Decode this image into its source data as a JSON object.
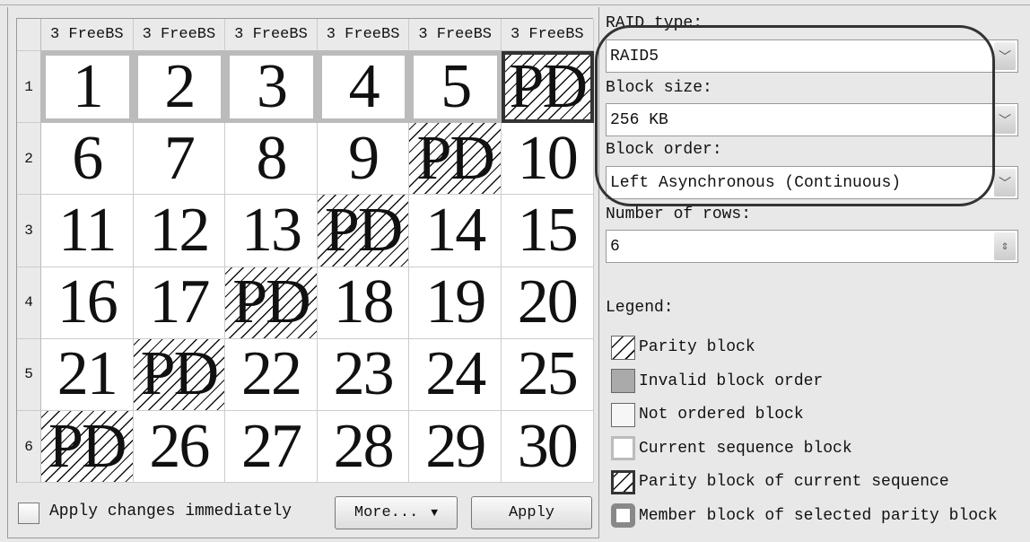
{
  "grid": {
    "column_headers": [
      "3 FreeBS",
      "3 FreeBS",
      "3 FreeBS",
      "3 FreeBS",
      "3 FreeBS",
      "3 FreeBS"
    ],
    "row_headers": [
      "1",
      "2",
      "3",
      "4",
      "5",
      "6"
    ],
    "rows": [
      [
        {
          "text": "1",
          "type": "current"
        },
        {
          "text": "2",
          "type": "current"
        },
        {
          "text": "3",
          "type": "current"
        },
        {
          "text": "4",
          "type": "current"
        },
        {
          "text": "5",
          "type": "current"
        },
        {
          "text": "PD",
          "type": "current-parity"
        }
      ],
      [
        {
          "text": "6",
          "type": "normal"
        },
        {
          "text": "7",
          "type": "normal"
        },
        {
          "text": "8",
          "type": "normal"
        },
        {
          "text": "9",
          "type": "normal"
        },
        {
          "text": "PD",
          "type": "parity"
        },
        {
          "text": "10",
          "type": "normal"
        }
      ],
      [
        {
          "text": "11",
          "type": "normal"
        },
        {
          "text": "12",
          "type": "normal"
        },
        {
          "text": "13",
          "type": "normal"
        },
        {
          "text": "PD",
          "type": "parity"
        },
        {
          "text": "14",
          "type": "normal"
        },
        {
          "text": "15",
          "type": "normal"
        }
      ],
      [
        {
          "text": "16",
          "type": "normal"
        },
        {
          "text": "17",
          "type": "normal"
        },
        {
          "text": "PD",
          "type": "parity"
        },
        {
          "text": "18",
          "type": "normal"
        },
        {
          "text": "19",
          "type": "normal"
        },
        {
          "text": "20",
          "type": "normal"
        }
      ],
      [
        {
          "text": "21",
          "type": "normal"
        },
        {
          "text": "PD",
          "type": "parity"
        },
        {
          "text": "22",
          "type": "normal"
        },
        {
          "text": "23",
          "type": "normal"
        },
        {
          "text": "24",
          "type": "normal"
        },
        {
          "text": "25",
          "type": "normal"
        }
      ],
      [
        {
          "text": "PD",
          "type": "parity"
        },
        {
          "text": "26",
          "type": "normal"
        },
        {
          "text": "27",
          "type": "normal"
        },
        {
          "text": "28",
          "type": "normal"
        },
        {
          "text": "29",
          "type": "normal"
        },
        {
          "text": "30",
          "type": "normal"
        }
      ]
    ]
  },
  "footer": {
    "apply_immediately_label": "Apply changes immediately",
    "apply_immediately_checked": false,
    "more_label": "More...",
    "more_arrow": "▼",
    "apply_label": "Apply"
  },
  "settings": {
    "raid_type_label": "RAID type:",
    "raid_type_value": "RAID5",
    "block_size_label": "Block size:",
    "block_size_value": "256 KB",
    "block_order_label": "Block order:",
    "block_order_value": "Left Asynchronous (Continuous)",
    "rows_label": "Number of rows:",
    "rows_value": "6",
    "dropdown_arrow": "﹀",
    "spin_arrows": "⇕"
  },
  "legend": {
    "title": "Legend:",
    "items": [
      {
        "label": "Parity block",
        "swatch": "parity"
      },
      {
        "label": "Invalid block order",
        "swatch": "invalid"
      },
      {
        "label": "Not ordered block",
        "swatch": "notord"
      },
      {
        "label": "Current sequence block",
        "swatch": "cur"
      },
      {
        "label": "Parity block of current sequence",
        "swatch": "curpar"
      },
      {
        "label": "Member block of selected parity block",
        "swatch": "member"
      }
    ]
  }
}
